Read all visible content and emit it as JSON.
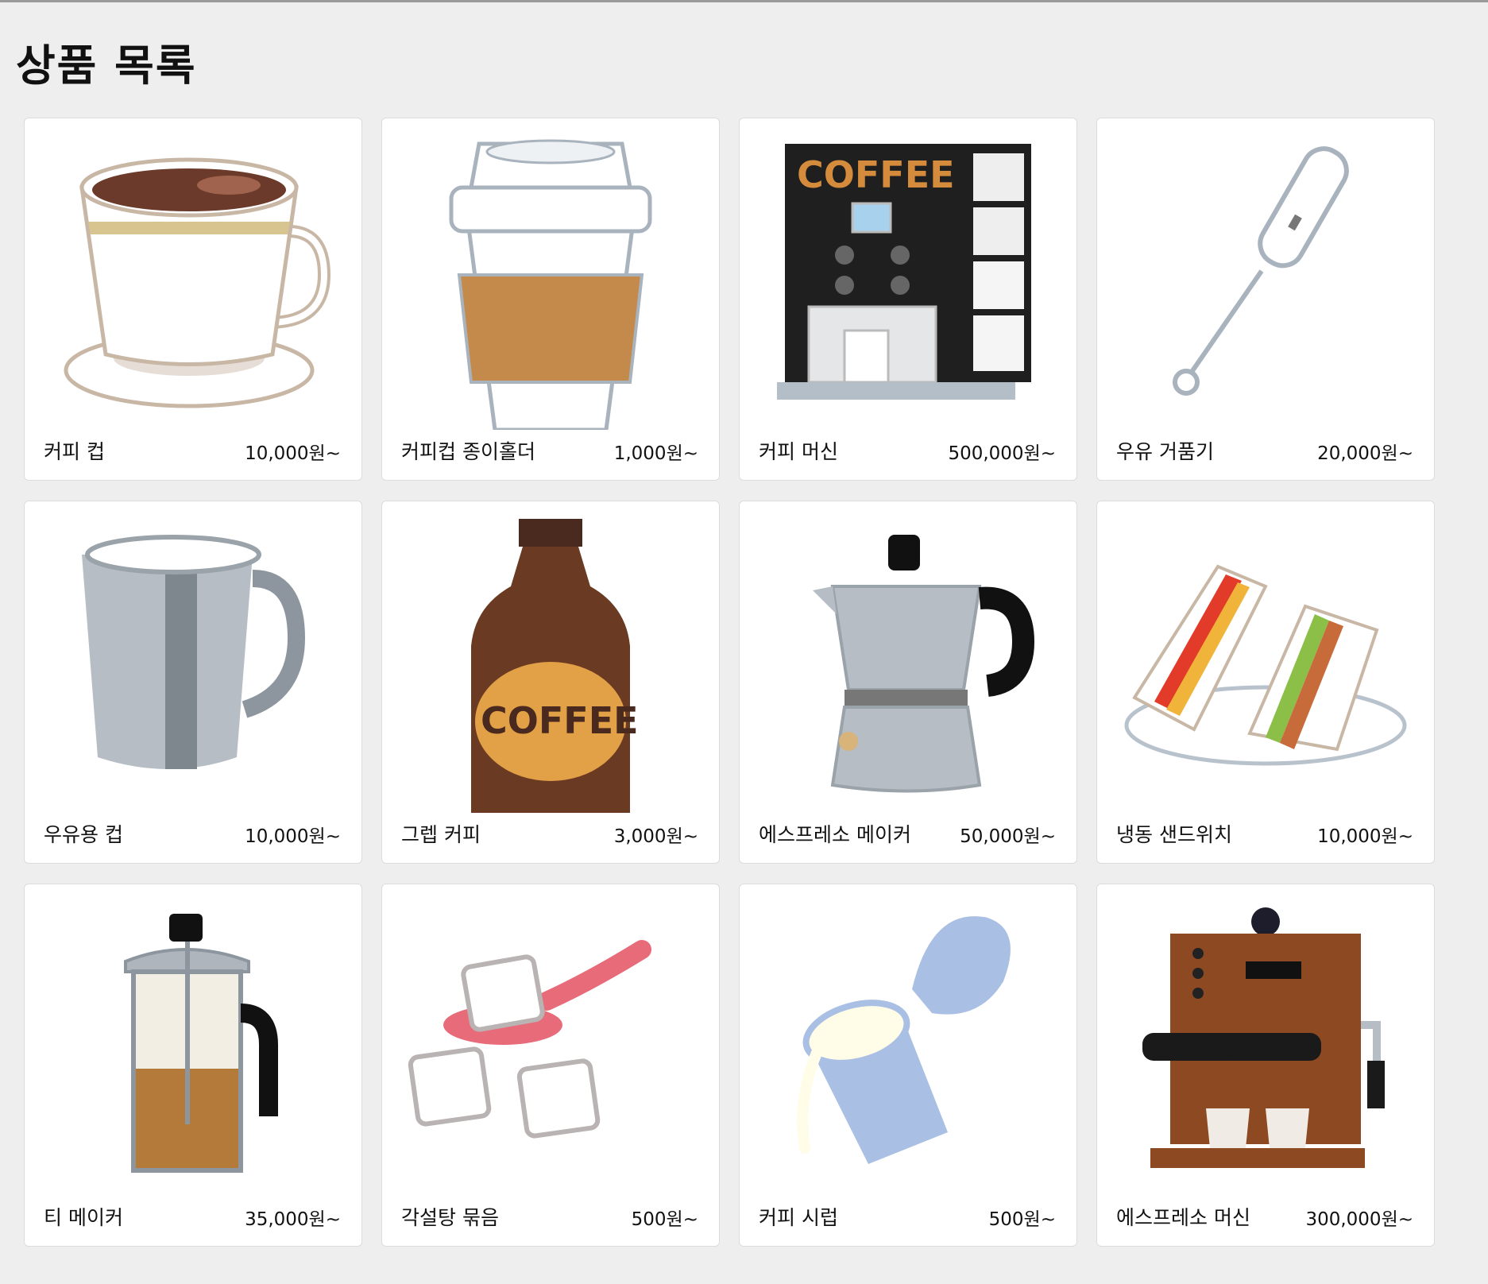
{
  "page": {
    "title": "상품 목록"
  },
  "products": [
    {
      "name": "커피 컵",
      "price": "10,000원~",
      "icon": "coffee-cup-icon"
    },
    {
      "name": "커피컵 종이홀더",
      "price": "1,000원~",
      "icon": "paper-cup-holder-icon"
    },
    {
      "name": "커피 머신",
      "price": "500,000원~",
      "icon": "coffee-machine-icon",
      "label": "COFFEE"
    },
    {
      "name": "우유 거품기",
      "price": "20,000원~",
      "icon": "milk-frother-icon"
    },
    {
      "name": "우유용 컵",
      "price": "10,000원~",
      "icon": "milk-pitcher-icon"
    },
    {
      "name": "그렙 커피",
      "price": "3,000원~",
      "icon": "coffee-bottle-icon",
      "label": "COFFEE"
    },
    {
      "name": "에스프레소 메이커",
      "price": "50,000원~",
      "icon": "moka-pot-icon"
    },
    {
      "name": "냉동 샌드위치",
      "price": "10,000원~",
      "icon": "sandwich-icon"
    },
    {
      "name": "티 메이커",
      "price": "35,000원~",
      "icon": "french-press-icon"
    },
    {
      "name": "각설탕 묶음",
      "price": "500원~",
      "icon": "sugar-cubes-icon"
    },
    {
      "name": "커피 시럽",
      "price": "500원~",
      "icon": "coffee-creamer-icon"
    },
    {
      "name": "에스프레소 머신",
      "price": "300,000원~",
      "icon": "espresso-machine-icon"
    }
  ]
}
